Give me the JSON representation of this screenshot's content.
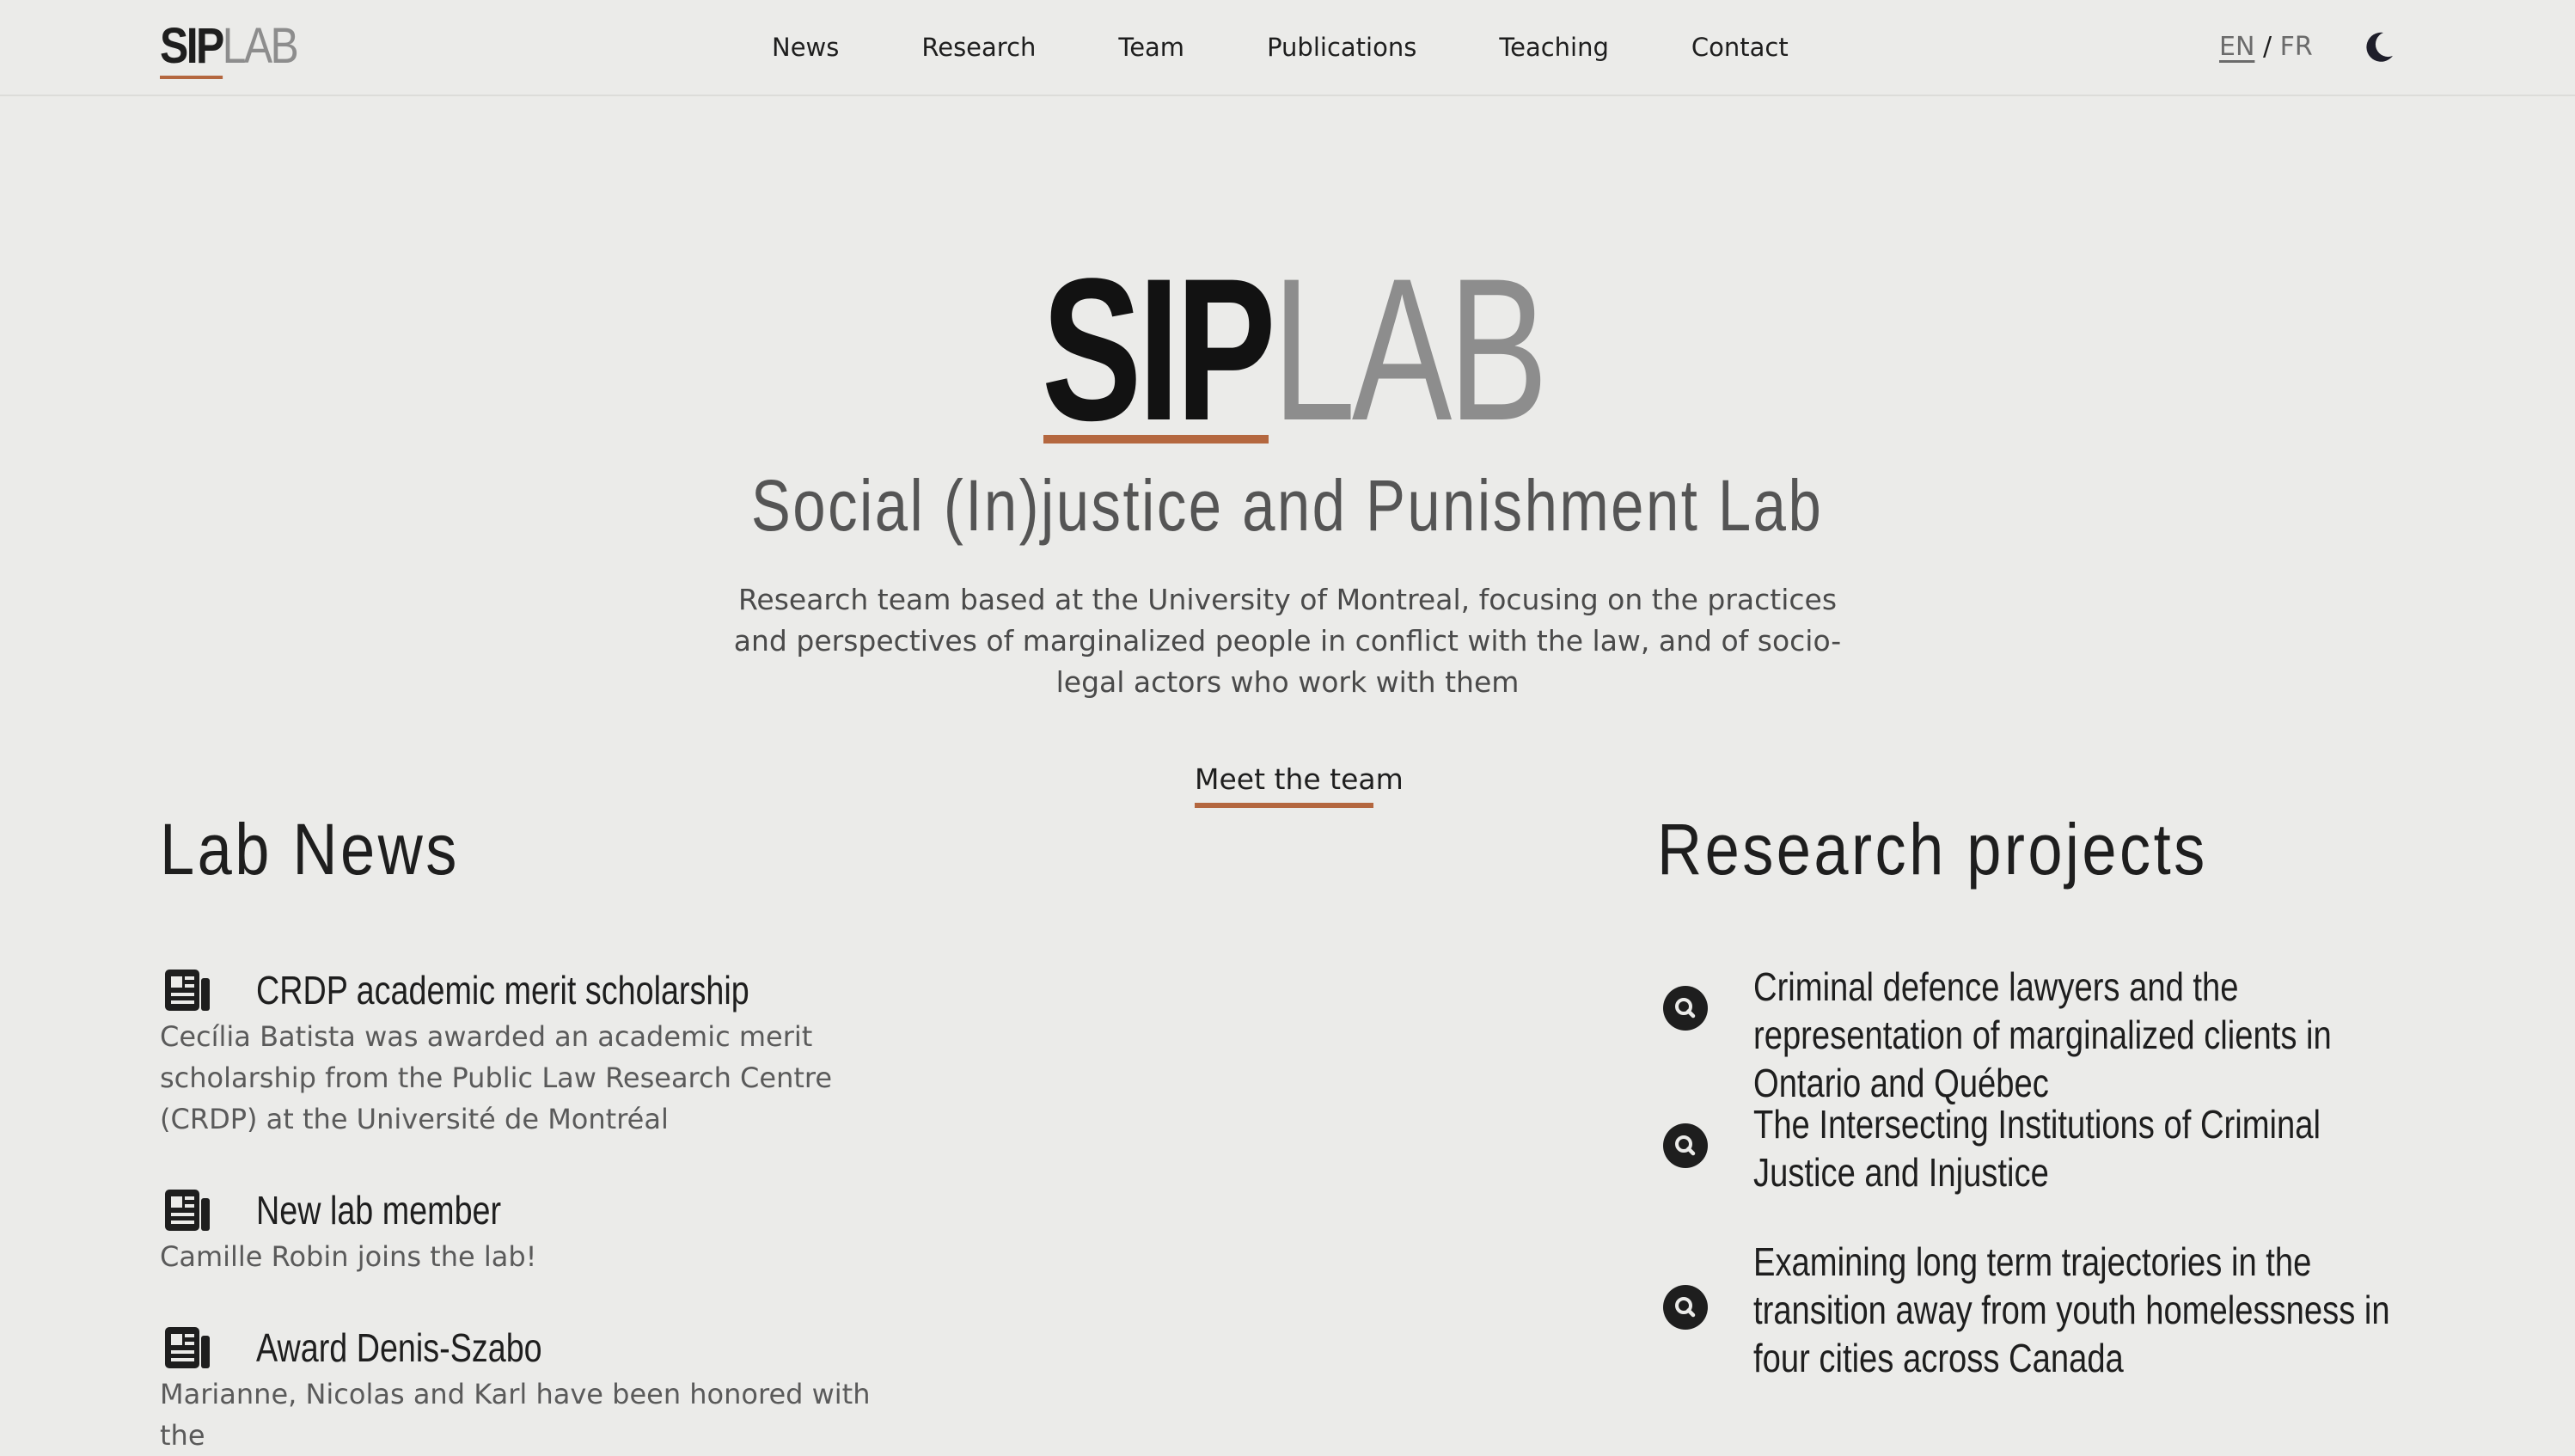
{
  "header": {
    "logo": {
      "sip": "SIP",
      "lab": "LAB"
    },
    "nav": [
      {
        "label": "News"
      },
      {
        "label": "Research"
      },
      {
        "label": "Team"
      },
      {
        "label": "Publications"
      },
      {
        "label": "Teaching"
      },
      {
        "label": "Contact"
      }
    ],
    "lang": {
      "en": "EN",
      "separator": "/",
      "fr": "FR",
      "active": "EN"
    },
    "theme_toggle_icon": "moon-icon"
  },
  "hero": {
    "logo": {
      "sip": "SIP",
      "lab": "LAB"
    },
    "subtitle": "Social (In)justice and Punishment Lab",
    "description": "Research team based at the University of Montreal, focusing on the practices and perspectives of marginalized people in conflict with the law, and of socio-legal actors who work with them",
    "cta_label": "Meet the team"
  },
  "news": {
    "title": "Lab News",
    "icon": "newspaper-icon",
    "items": [
      {
        "title": "CRDP academic merit scholarship",
        "body": "Cecília Batista was awarded an academic merit scholarship from the Public Law Research Centre (CRDP) at the Université de Montréal"
      },
      {
        "title": "New lab member",
        "body": "Camille Robin joins the lab!"
      },
      {
        "title": "Award Denis-Szabo",
        "body": "Marianne, Nicolas and Karl have been honored with the"
      }
    ]
  },
  "research": {
    "title": "Research projects",
    "icon": "search-icon",
    "items": [
      {
        "title": "Criminal defence lawyers and the representation of marginalized clients in Ontario and Québec"
      },
      {
        "title": "The Intersecting Institutions of Criminal Justice and Injustice"
      },
      {
        "title": "Examining long term trajectories in the transition away from youth homelessness in four cities across Canada"
      }
    ]
  },
  "colors": {
    "background": "#ebebe9",
    "accent": "#b4673f",
    "text": "#1e1e1e",
    "muted": "#8d8d8d"
  }
}
